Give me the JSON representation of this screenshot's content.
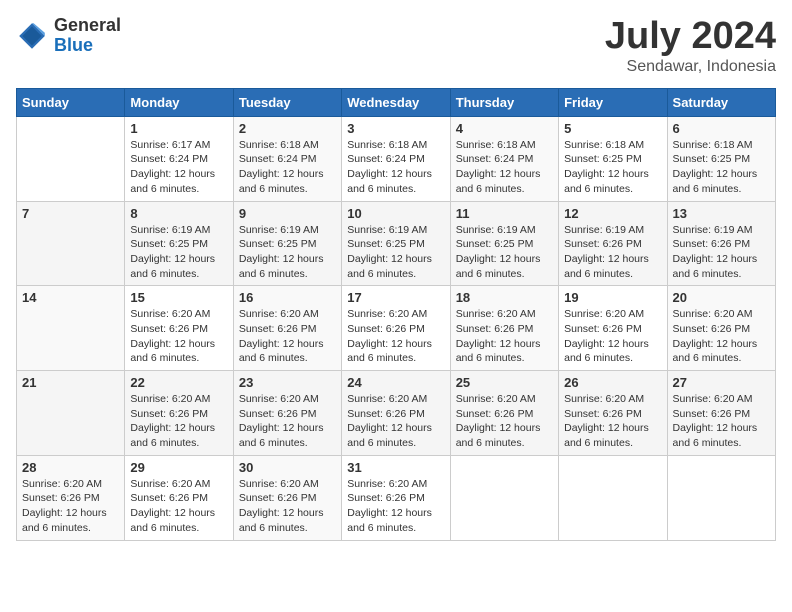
{
  "header": {
    "logo_general": "General",
    "logo_blue": "Blue",
    "month": "July 2024",
    "location": "Sendawar, Indonesia"
  },
  "days_of_week": [
    "Sunday",
    "Monday",
    "Tuesday",
    "Wednesday",
    "Thursday",
    "Friday",
    "Saturday"
  ],
  "weeks": [
    [
      {
        "day": "",
        "info": ""
      },
      {
        "day": "1",
        "info": "Sunrise: 6:17 AM\nSunset: 6:24 PM\nDaylight: 12 hours\nand 6 minutes."
      },
      {
        "day": "2",
        "info": "Sunrise: 6:18 AM\nSunset: 6:24 PM\nDaylight: 12 hours\nand 6 minutes."
      },
      {
        "day": "3",
        "info": "Sunrise: 6:18 AM\nSunset: 6:24 PM\nDaylight: 12 hours\nand 6 minutes."
      },
      {
        "day": "4",
        "info": "Sunrise: 6:18 AM\nSunset: 6:24 PM\nDaylight: 12 hours\nand 6 minutes."
      },
      {
        "day": "5",
        "info": "Sunrise: 6:18 AM\nSunset: 6:25 PM\nDaylight: 12 hours\nand 6 minutes."
      },
      {
        "day": "6",
        "info": "Sunrise: 6:18 AM\nSunset: 6:25 PM\nDaylight: 12 hours\nand 6 minutes."
      }
    ],
    [
      {
        "day": "7",
        "info": ""
      },
      {
        "day": "8",
        "info": "Sunrise: 6:19 AM\nSunset: 6:25 PM\nDaylight: 12 hours\nand 6 minutes."
      },
      {
        "day": "9",
        "info": "Sunrise: 6:19 AM\nSunset: 6:25 PM\nDaylight: 12 hours\nand 6 minutes."
      },
      {
        "day": "10",
        "info": "Sunrise: 6:19 AM\nSunset: 6:25 PM\nDaylight: 12 hours\nand 6 minutes."
      },
      {
        "day": "11",
        "info": "Sunrise: 6:19 AM\nSunset: 6:25 PM\nDaylight: 12 hours\nand 6 minutes."
      },
      {
        "day": "12",
        "info": "Sunrise: 6:19 AM\nSunset: 6:26 PM\nDaylight: 12 hours\nand 6 minutes."
      },
      {
        "day": "13",
        "info": "Sunrise: 6:19 AM\nSunset: 6:26 PM\nDaylight: 12 hours\nand 6 minutes."
      }
    ],
    [
      {
        "day": "14",
        "info": ""
      },
      {
        "day": "15",
        "info": "Sunrise: 6:20 AM\nSunset: 6:26 PM\nDaylight: 12 hours\nand 6 minutes."
      },
      {
        "day": "16",
        "info": "Sunrise: 6:20 AM\nSunset: 6:26 PM\nDaylight: 12 hours\nand 6 minutes."
      },
      {
        "day": "17",
        "info": "Sunrise: 6:20 AM\nSunset: 6:26 PM\nDaylight: 12 hours\nand 6 minutes."
      },
      {
        "day": "18",
        "info": "Sunrise: 6:20 AM\nSunset: 6:26 PM\nDaylight: 12 hours\nand 6 minutes."
      },
      {
        "day": "19",
        "info": "Sunrise: 6:20 AM\nSunset: 6:26 PM\nDaylight: 12 hours\nand 6 minutes."
      },
      {
        "day": "20",
        "info": "Sunrise: 6:20 AM\nSunset: 6:26 PM\nDaylight: 12 hours\nand 6 minutes."
      }
    ],
    [
      {
        "day": "21",
        "info": ""
      },
      {
        "day": "22",
        "info": "Sunrise: 6:20 AM\nSunset: 6:26 PM\nDaylight: 12 hours\nand 6 minutes."
      },
      {
        "day": "23",
        "info": "Sunrise: 6:20 AM\nSunset: 6:26 PM\nDaylight: 12 hours\nand 6 minutes."
      },
      {
        "day": "24",
        "info": "Sunrise: 6:20 AM\nSunset: 6:26 PM\nDaylight: 12 hours\nand 6 minutes."
      },
      {
        "day": "25",
        "info": "Sunrise: 6:20 AM\nSunset: 6:26 PM\nDaylight: 12 hours\nand 6 minutes."
      },
      {
        "day": "26",
        "info": "Sunrise: 6:20 AM\nSunset: 6:26 PM\nDaylight: 12 hours\nand 6 minutes."
      },
      {
        "day": "27",
        "info": "Sunrise: 6:20 AM\nSunset: 6:26 PM\nDaylight: 12 hours\nand 6 minutes."
      }
    ],
    [
      {
        "day": "28",
        "info": "Sunrise: 6:20 AM\nSunset: 6:26 PM\nDaylight: 12 hours\nand 6 minutes."
      },
      {
        "day": "29",
        "info": "Sunrise: 6:20 AM\nSunset: 6:26 PM\nDaylight: 12 hours\nand 6 minutes."
      },
      {
        "day": "30",
        "info": "Sunrise: 6:20 AM\nSunset: 6:26 PM\nDaylight: 12 hours\nand 6 minutes."
      },
      {
        "day": "31",
        "info": "Sunrise: 6:20 AM\nSunset: 6:26 PM\nDaylight: 12 hours\nand 6 minutes."
      },
      {
        "day": "",
        "info": ""
      },
      {
        "day": "",
        "info": ""
      },
      {
        "day": "",
        "info": ""
      }
    ]
  ]
}
